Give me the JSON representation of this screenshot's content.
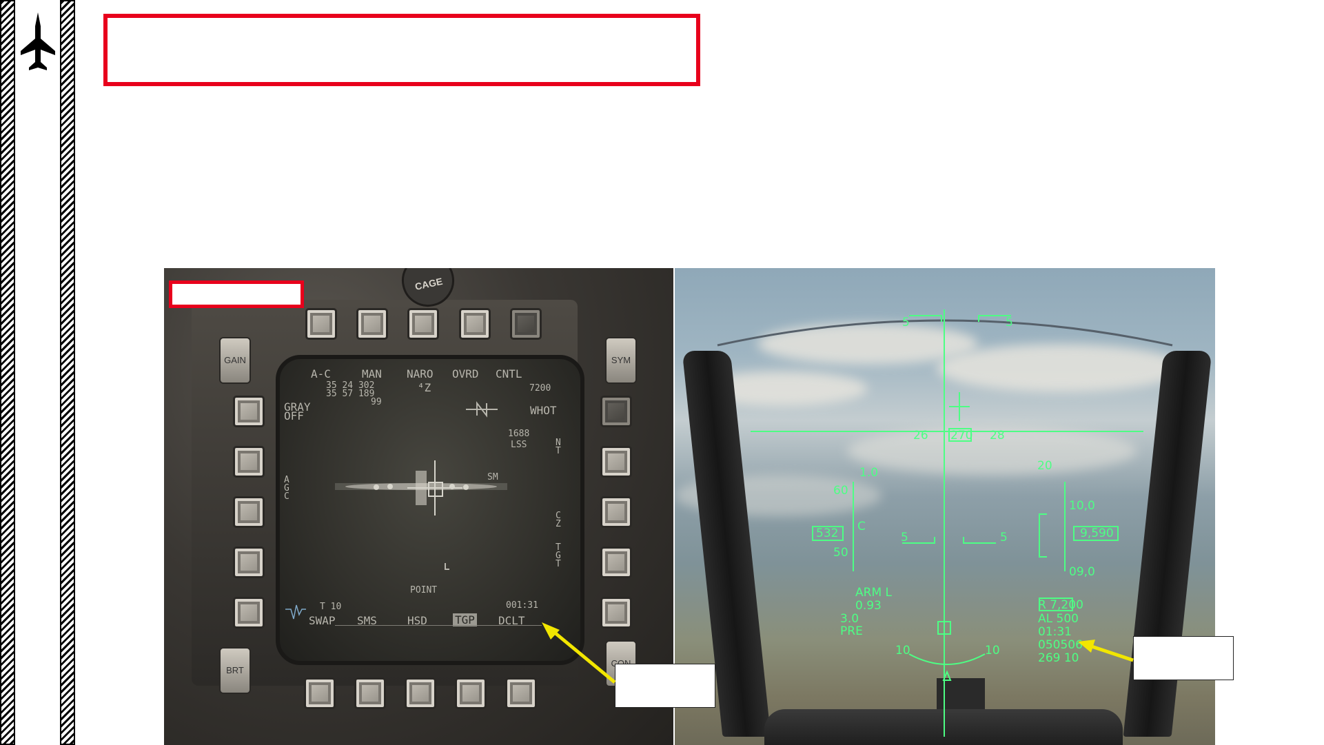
{
  "mfd": {
    "osb_top": [
      "A-C",
      "MAN",
      "NARO",
      "OVRD",
      "CNTL"
    ],
    "sub_row1": "35 24  302",
    "sub_row2": "35 57  189",
    "sub_row3": "99",
    "zoom": "⁴Z",
    "code": "7200",
    "gray_off_1": "GRAY",
    "gray_off_2": "OFF",
    "whot": "WHOT",
    "laser_code": "1688",
    "lss": "LSS",
    "nt_1": "N",
    "nt_2": "T",
    "agc_1": "A",
    "agc_2": "G",
    "agc_3": "C",
    "sm": "SM",
    "cz_1": "C",
    "cz_2": "Z",
    "tgt_1": "T",
    "tgt_2": "G",
    "tgt_3": "T",
    "point": "POINT",
    "timer": "001:31",
    "t10": "T 10",
    "osb_bottom": [
      "SWAP",
      "SMS",
      "HSD",
      "TGP",
      "DCLT"
    ],
    "gain": "GAIN",
    "sym": "SYM",
    "brt": "BRT",
    "con": "CON",
    "cage_text": "CAGE"
  },
  "hud": {
    "pitch_top_left": "5",
    "pitch_top_right": "5",
    "heading_left": "26",
    "heading_center": "270",
    "heading_right": "28",
    "mach": "1.0",
    "g_load": "20",
    "spd_60": "60",
    "spd_50": "50",
    "airspeed": "532",
    "speed_c": "C",
    "alt_100": "10,0",
    "alt_090": "09,0",
    "altitude": "9,590",
    "pitch_mid_left": "5",
    "pitch_mid_right": "5",
    "arm": "ARM  L",
    "mach_val": "0.93",
    "g_max": "3.0",
    "pre": "PRE",
    "radar_alt": "R 7,200",
    "al": "AL   500",
    "time": "01:31",
    "steerpoint": "050506",
    "bearing": "269   10",
    "bank_left": "10",
    "bank_right": "10"
  },
  "colors": {
    "hud_green": "#4dff84",
    "title_border": "#e8001c",
    "arrow": "#f2e600"
  }
}
